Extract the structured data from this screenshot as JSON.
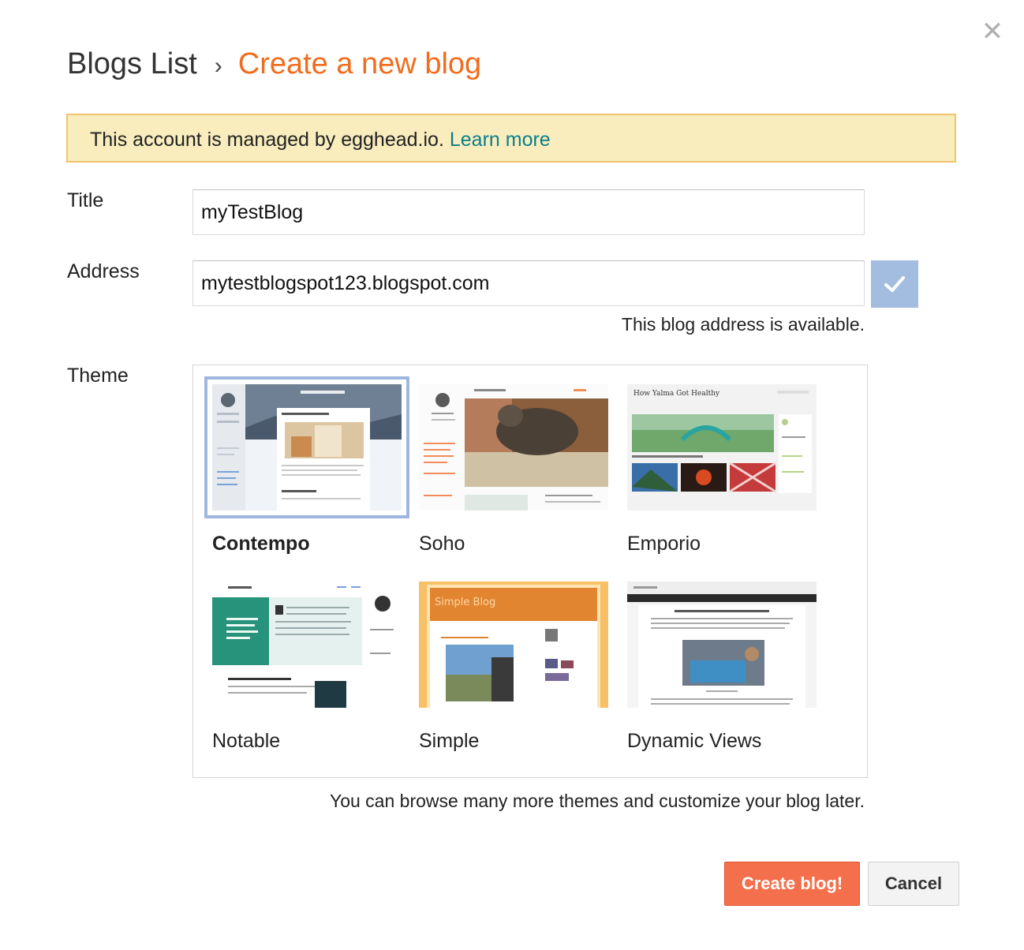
{
  "dialog": {
    "close_label": "✕"
  },
  "breadcrumb": {
    "root": "Blogs List",
    "separator": "›",
    "current": "Create a new blog"
  },
  "notice": {
    "text": "This account is managed by egghead.io.",
    "link": "Learn more"
  },
  "form": {
    "title_label": "Title",
    "title_value": "myTestBlog",
    "address_label": "Address",
    "address_value": "mytestblogspot123.blogspot.com",
    "address_status": "This blog address is available.",
    "theme_label": "Theme"
  },
  "themes": [
    {
      "name": "Contempo",
      "selected": true
    },
    {
      "name": "Soho",
      "selected": false
    },
    {
      "name": "Emporio",
      "selected": false
    },
    {
      "name": "Notable",
      "selected": false
    },
    {
      "name": "Simple",
      "selected": false
    },
    {
      "name": "Dynamic Views",
      "selected": false
    }
  ],
  "theme_thumb_text": {
    "emporio_title": "How Yalma Got Healthy",
    "simple_title": "Simple Blog"
  },
  "browse_note": "You can browse many more themes and customize your blog later.",
  "buttons": {
    "create": "Create blog!",
    "cancel": "Cancel"
  },
  "colors": {
    "accent_orange": "#f26c1c",
    "link_teal": "#0b7e8a",
    "notice_bg": "#f9edbe",
    "create_button": "#f4704d",
    "check_button": "#a3bde0"
  }
}
